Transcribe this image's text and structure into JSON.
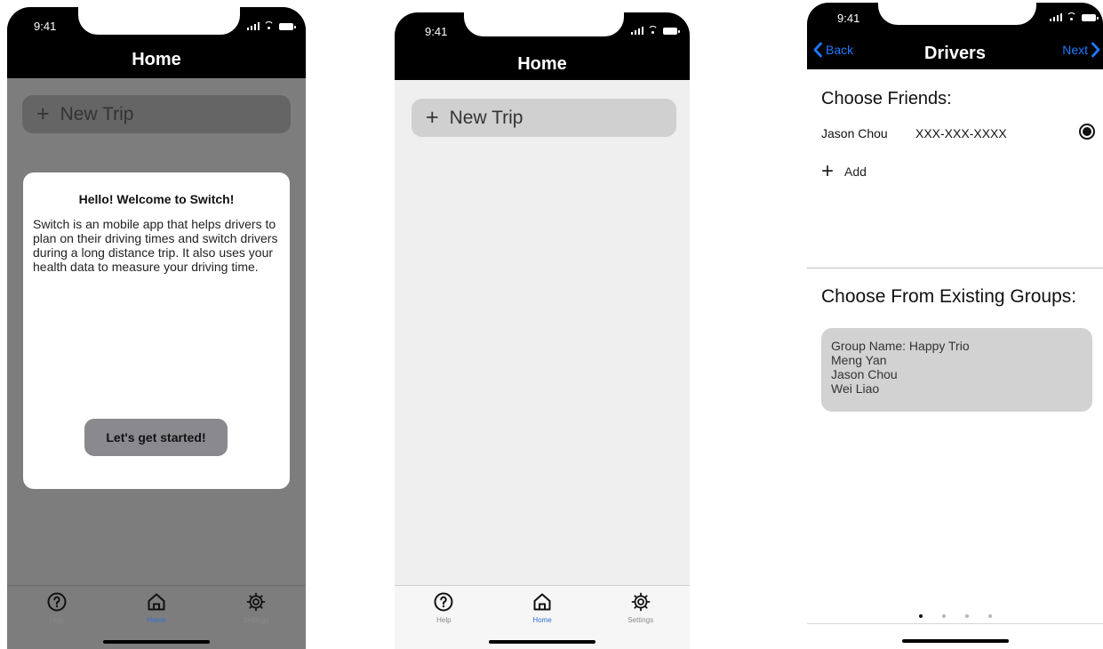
{
  "colors": {
    "accent": "#1f7aff",
    "tab_active": "#2f6fd6",
    "overlay": "#7d7d7d",
    "card": "#d2d2d2"
  },
  "screens": [
    {
      "status_time": "9:41",
      "nav_title": "Home",
      "new_trip_label": "New Trip",
      "modal": {
        "title": "Hello! Welcome to Switch!",
        "body": "Switch is an mobile app that helps drivers to plan on their driving times and switch drivers during a long distance trip. It also uses your health data to measure your driving time.",
        "button": "Let's get started!"
      },
      "tabs": [
        {
          "label": "Help",
          "icon": "help-icon"
        },
        {
          "label": "Home",
          "icon": "home-icon",
          "active": true
        },
        {
          "label": "Settings",
          "icon": "gear-icon"
        }
      ]
    },
    {
      "status_time": "9:41",
      "nav_title": "Home",
      "new_trip_label": "New Trip",
      "tabs": [
        {
          "label": "Help",
          "icon": "help-icon"
        },
        {
          "label": "Home",
          "icon": "home-icon",
          "active": true
        },
        {
          "label": "Settings",
          "icon": "gear-icon"
        }
      ]
    },
    {
      "status_time": "9:41",
      "nav_title": "Drivers",
      "back_label": "Back",
      "next_label": "Next",
      "choose_friends_title": "Choose Friends:",
      "friend": {
        "name": "Jason Chou",
        "phone": "XXX-XXX-XXXX",
        "selected": true
      },
      "add_label": "Add",
      "groups_title": "Choose From Existing Groups:",
      "group": {
        "name_line": "Group Name: Happy Trio",
        "members": [
          "Meng Yan",
          "Jason Chou",
          "Wei Liao"
        ]
      },
      "page_dots": {
        "count": 4,
        "active": 1
      }
    }
  ]
}
